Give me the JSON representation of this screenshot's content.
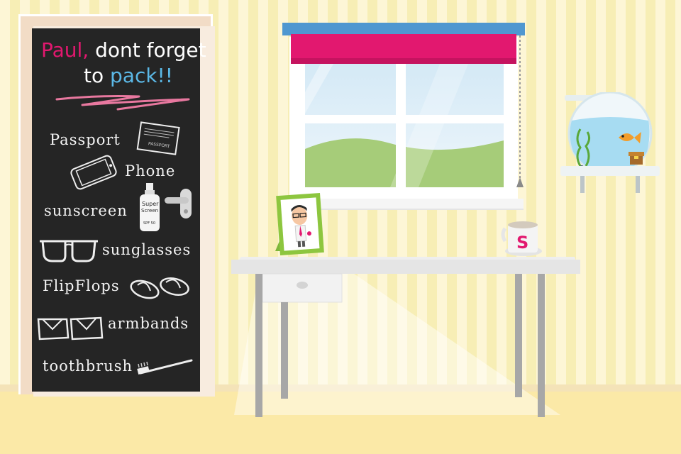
{
  "chalkboard": {
    "title_name": "Paul,",
    "title_rest": " dont forget",
    "title_line2_a": "to ",
    "title_line2_b": "pack!!",
    "items": [
      {
        "label": "Passport",
        "icon": "passport-icon"
      },
      {
        "label": "Phone",
        "icon": "phone-icon"
      },
      {
        "label": "sunscreen",
        "icon": "sunscreen-icon"
      },
      {
        "label": "sunglasses",
        "icon": "sunglasses-icon"
      },
      {
        "label": "FlipFlops",
        "icon": "flipflops-icon"
      },
      {
        "label": "armbands",
        "icon": "armbands-icon"
      },
      {
        "label": "toothbrush",
        "icon": "toothbrush-icon"
      }
    ],
    "passport_text": "PASSPORT",
    "sunscreen_brand_1": "Super",
    "sunscreen_brand_2": "Screen",
    "sunscreen_spf": "SPF 50"
  },
  "mug": {
    "letter": "S"
  },
  "colors": {
    "pink": "#e2186f",
    "blue": "#5bb8e6",
    "chalkboard": "#252525",
    "blind_rail": "#4f97d0",
    "frame_green": "#8dc63f"
  }
}
